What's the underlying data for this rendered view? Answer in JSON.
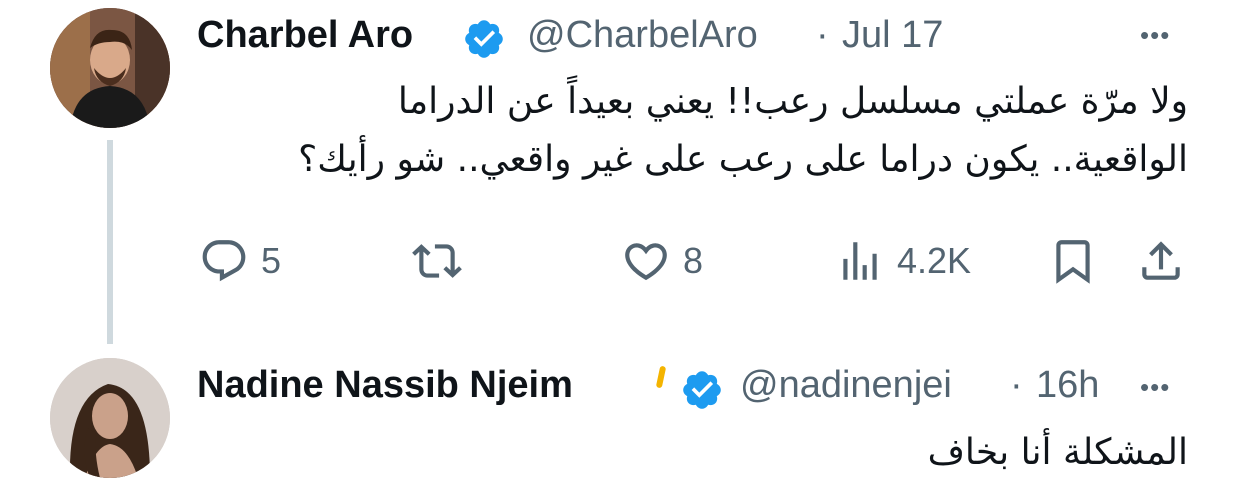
{
  "tweet": {
    "author_name": "Charbel Aro",
    "handle": "@CharbelAro",
    "separator": "·",
    "date": "Jul 17",
    "more": "•••",
    "text_line1": "ولا مرّة عملتي مسلسل رعب!! يعني بعيداً عن الدراما",
    "text_line2": "الواقعية.. يكون دراما على رعب على غير واقعي.. شو رأيك؟",
    "actions": {
      "replies": "5",
      "likes": "8",
      "views": "4.2K"
    }
  },
  "reply": {
    "author_name": "Nadine Nassib Njeim",
    "emoji": "🟡",
    "handle": "@nadinenjei",
    "separator": "·",
    "time": "16h",
    "more": "•••",
    "text": "المشكلة أنا بخاف"
  },
  "colors": {
    "verified": "#1d9bf0",
    "muted": "#536471",
    "thread": "#cfd9de"
  },
  "icons": [
    "reply-icon",
    "retweet-icon",
    "like-icon",
    "views-icon",
    "bookmark-icon",
    "share-icon",
    "verified-badge-icon"
  ]
}
